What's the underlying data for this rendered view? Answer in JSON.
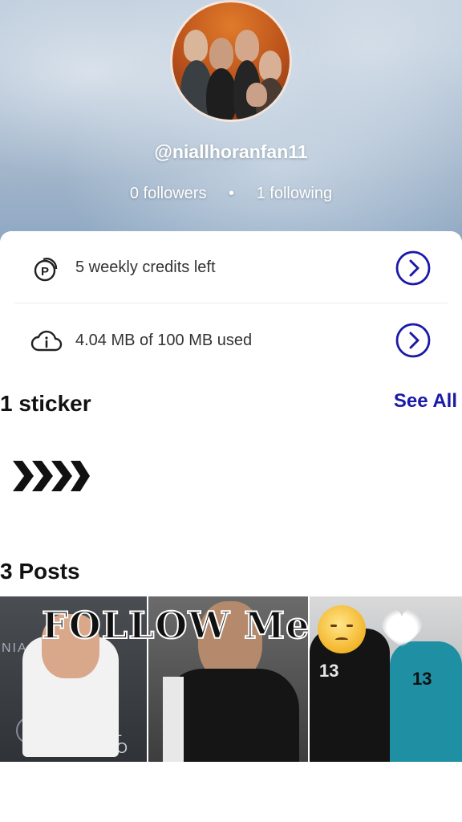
{
  "profile": {
    "handle": "@niallhoranfan11",
    "followers": "0 followers",
    "separator": "•",
    "following": "1 following"
  },
  "account": {
    "credits_label": "5 weekly credits left",
    "storage_label": "4.04 MB of 100 MB used"
  },
  "stickers": {
    "title": "1 sticker",
    "see_all": "See All"
  },
  "posts": {
    "title": "3 Posts",
    "tile1_text_a": "NIA",
    "tile1_text_b": "LL HO",
    "tile3_number_a": "13",
    "tile3_number_b": "13"
  },
  "overlay": {
    "text": "FOLLOW Me"
  },
  "colors": {
    "accent": "#1a1aa8",
    "header_sky": "#a7bbd0"
  }
}
